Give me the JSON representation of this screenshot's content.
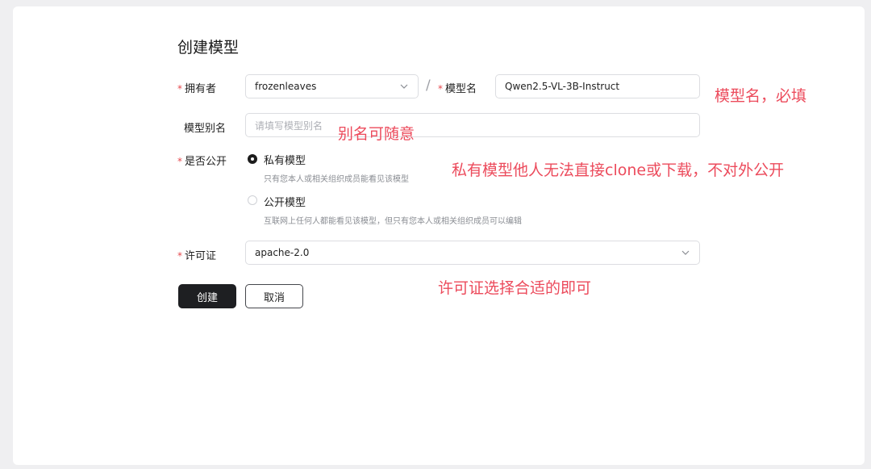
{
  "page": {
    "title": "创建模型"
  },
  "form": {
    "owner": {
      "label": "拥有者",
      "required_mark": "*",
      "value": "frozenleaves"
    },
    "separator": "/",
    "model_name": {
      "label": "模型名",
      "required_mark": "*",
      "value": "Qwen2.5-VL-3B-Instruct"
    },
    "alias": {
      "label": "模型别名",
      "placeholder": "请填写模型别名"
    },
    "visibility": {
      "label": "是否公开",
      "required_mark": "*",
      "options": [
        {
          "label": "私有模型",
          "desc": "只有您本人或相关组织成员能看见该模型",
          "selected": true
        },
        {
          "label": "公开模型",
          "desc": "互联网上任何人都能看见该模型，但只有您本人或相关组织成员可以编辑",
          "selected": false
        }
      ]
    },
    "license": {
      "label": "许可证",
      "required_mark": "*",
      "value": "apache-2.0"
    },
    "buttons": {
      "create": "创建",
      "cancel": "取消"
    }
  },
  "annotations": {
    "model_name_note": "模型名，必填",
    "alias_note": "别名可随意",
    "visibility_note": "私有模型他人无法直接clone或下载，不对外公开",
    "license_note": "许可证选择合适的即可"
  },
  "colors": {
    "annotation": "#ec4b5c",
    "required": "#e5484d",
    "primary_button": "#1e1f22"
  },
  "icons": {
    "dropdown": "chevron-down-icon"
  }
}
